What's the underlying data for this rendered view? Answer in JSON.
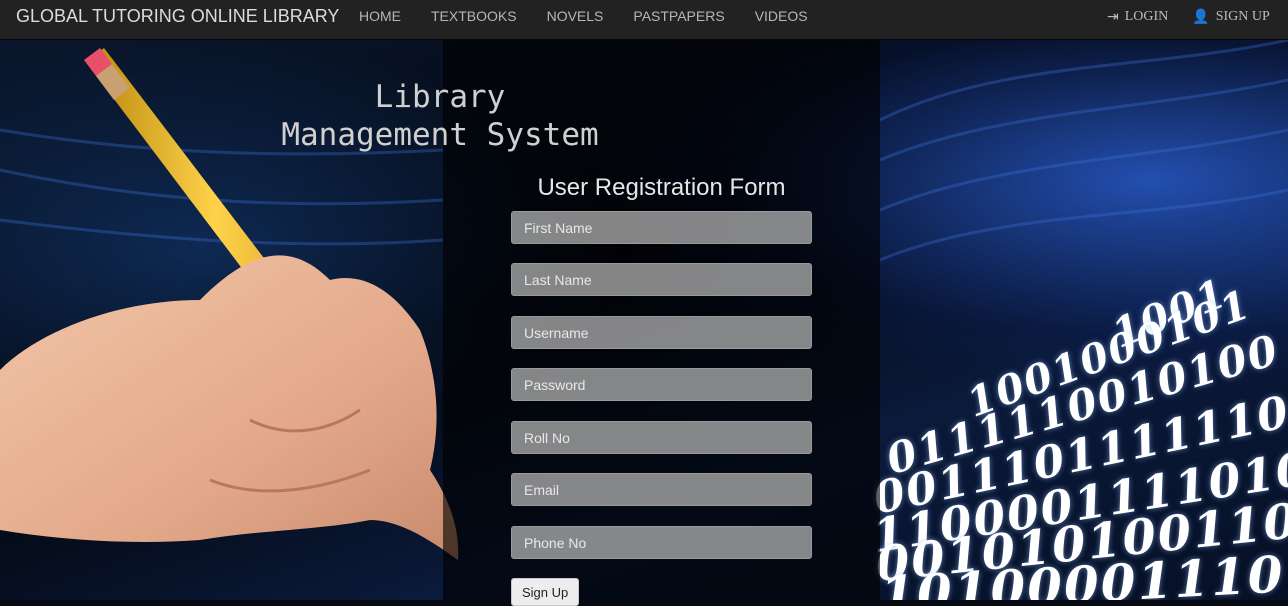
{
  "navbar": {
    "brand": "GLOBAL TUTORING ONLINE LIBRARY",
    "links": [
      "HOME",
      "TEXTBOOKS",
      "NOVELS",
      "PASTPAPERS",
      "VIDEOS"
    ],
    "login_label": "LOGIN",
    "signup_label": "SIGN UP"
  },
  "main": {
    "system_title": "Library\nManagement System",
    "form_title": "User Registration Form",
    "fields": {
      "first_name": "First Name",
      "last_name": "Last Name",
      "username": "Username",
      "password": "Password",
      "roll_no": "Roll No",
      "email": "Email",
      "phone_no": "Phone No"
    },
    "submit_label": "Sign Up"
  },
  "background": {
    "binary_rows": [
      "1001",
      "1001000101",
      "0111110010100",
      "0011101111110",
      "1100001111010",
      "001010100110",
      "10100001110"
    ]
  },
  "colors": {
    "navbar_bg": "#222222",
    "accent_blue": "#2a5cc8",
    "panel_overlay": "rgba(0,0,0,0.62)"
  },
  "icons": {
    "login": "log-in-icon",
    "signup": "user-icon",
    "hero_image": "pencil-hand-image"
  }
}
